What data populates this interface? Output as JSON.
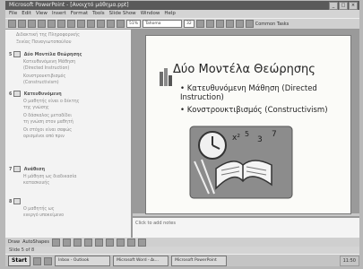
{
  "window": {
    "title": "Microsoft PowerPoint - [Ανοιχτό μάθημα.ppt]",
    "controls": [
      "_",
      "□",
      "×"
    ]
  },
  "menu": [
    "File",
    "Edit",
    "View",
    "Insert",
    "Format",
    "Tools",
    "Slide Show",
    "Window",
    "Help"
  ],
  "toolbar": {
    "zoom": "51%",
    "font": "Tahoma",
    "font_size": "32",
    "common_tasks": "Common Tasks"
  },
  "outline": [
    {
      "num": "",
      "text": "Διδακτική της Πληροφορικής",
      "level": 2
    },
    {
      "num": "",
      "text": "Ξενίας Παναγιωτοπούλου",
      "level": 2
    },
    {
      "num": "5",
      "text": "Δύο Μοντέλα Θεώρησης",
      "level": 1
    },
    {
      "num": "",
      "text": "Κατευθυνόμενη Μάθηση",
      "level": 2
    },
    {
      "num": "",
      "text": "(Directed Instruction)",
      "level": 2
    },
    {
      "num": "",
      "text": "Κονστρουκτιβισμός",
      "level": 2
    },
    {
      "num": "",
      "text": "(Constructivism)",
      "level": 2
    },
    {
      "num": "6",
      "text": "Κατευθυνόμενη",
      "level": 1
    },
    {
      "num": "",
      "text": "Ο μαθητής είναι ο δέκτης",
      "level": 2
    },
    {
      "num": "",
      "text": "της γνώσης",
      "level": 2
    },
    {
      "num": "",
      "text": "Ο δάσκαλος μεταδίδει",
      "level": 2
    },
    {
      "num": "",
      "text": "τη γνώση στον μαθητή",
      "level": 2
    },
    {
      "num": "",
      "text": "Οι στόχοι είναι σαφώς",
      "level": 2
    },
    {
      "num": "",
      "text": "ορισμένοι από πριν",
      "level": 2
    },
    {
      "num": "7",
      "text": "Ανάθεση",
      "level": 1
    },
    {
      "num": "",
      "text": "Η μάθηση ως διαδικασία",
      "level": 2
    },
    {
      "num": "",
      "text": "κατασκευής",
      "level": 2
    },
    {
      "num": "8",
      "text": "",
      "level": 1
    },
    {
      "num": "",
      "text": "Ο μαθητής ως",
      "level": 2
    },
    {
      "num": "",
      "text": "ενεργό υποκείμενο",
      "level": 2
    }
  ],
  "slide": {
    "title": "Δύο Μοντέλα Θεώρησης",
    "bullets": [
      {
        "text": "Κατευθυνόμενη Μάθηση (Directed Instruction)"
      },
      {
        "text": "Κονστρουκτιβισμός (Constructivism)"
      }
    ]
  },
  "notes": {
    "placeholder": "Click to add notes"
  },
  "drawbar": {
    "draw": "Draw",
    "autoshapes": "AutoShapes"
  },
  "statusbar": {
    "text": "Slide 5 of 8"
  },
  "taskbar": {
    "start": "Start",
    "buttons": [
      "Inbox - Outlook",
      "Microsoft Word - Δι...",
      "Microsoft PowerPoint"
    ],
    "clock": "11:50"
  }
}
